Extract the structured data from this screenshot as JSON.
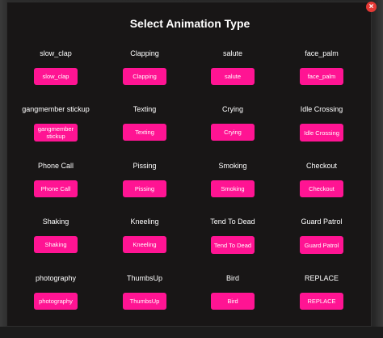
{
  "dialog": {
    "title": "Select Animation Type",
    "close_symbol": "×"
  },
  "animations": [
    {
      "label": "slow_clap",
      "button": "slow_clap"
    },
    {
      "label": "Clapping",
      "button": "Clapping"
    },
    {
      "label": "salute",
      "button": "salute"
    },
    {
      "label": "face_palm",
      "button": "face_palm"
    },
    {
      "label": "gangmember stickup",
      "button": "gangmember stickup"
    },
    {
      "label": "Texting",
      "button": "Texting"
    },
    {
      "label": "Crying",
      "button": "Crying"
    },
    {
      "label": "Idle Crossing",
      "button": "Idle Crossing"
    },
    {
      "label": "Phone Call",
      "button": "Phone Call"
    },
    {
      "label": "Pissing",
      "button": "Pissing"
    },
    {
      "label": "Smoking",
      "button": "Smoking"
    },
    {
      "label": "Checkout",
      "button": "Checkout"
    },
    {
      "label": "Shaking",
      "button": "Shaking"
    },
    {
      "label": "Kneeling",
      "button": "Kneeling"
    },
    {
      "label": "Tend To Dead",
      "button": "Tend To Dead"
    },
    {
      "label": "Guard Patrol",
      "button": "Guard Patrol"
    },
    {
      "label": "photography",
      "button": "photography"
    },
    {
      "label": "ThumbsUp",
      "button": "ThumbsUp"
    },
    {
      "label": "Bird",
      "button": "Bird"
    },
    {
      "label": "REPLACE",
      "button": "REPLACE"
    }
  ],
  "colors": {
    "accent": "#ff1493",
    "close": "#e53935",
    "background": "#181616"
  }
}
